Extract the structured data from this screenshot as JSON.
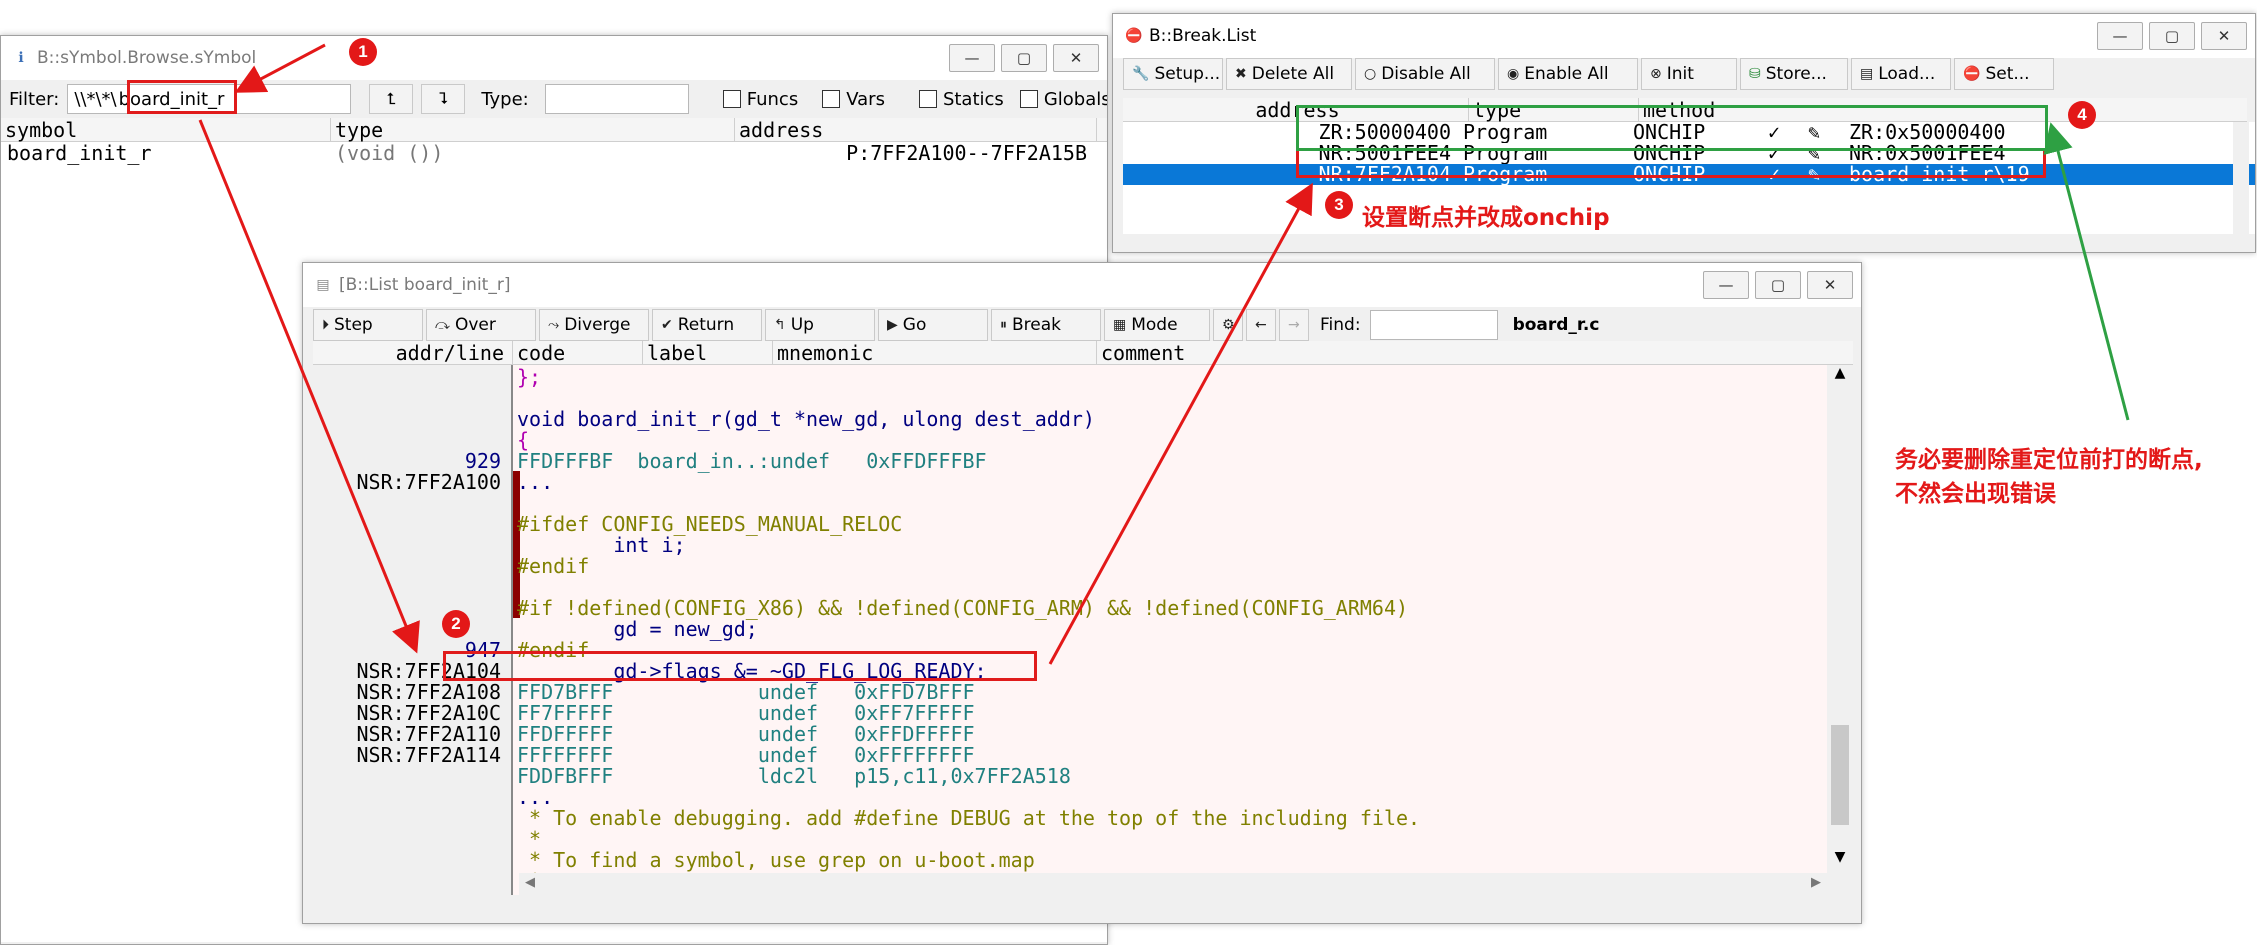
{
  "symbol_window": {
    "title": "B::sYmbol.Browse.sYmbol",
    "filter_label": "Filter:",
    "filter_prefix": "\\\\*\\*\\",
    "filter_value": "board_init_r",
    "type_label": "Type:",
    "type_value": "",
    "checkboxes": [
      "Funcs",
      "Vars",
      "Statics",
      "Globals"
    ],
    "columns": [
      "symbol",
      "type",
      "address"
    ],
    "rows": [
      {
        "symbol": "board_init_r",
        "type": "(void ())",
        "address": "P:7FF2A100--7FF2A15B"
      }
    ]
  },
  "break_window": {
    "title": "B::Break.List",
    "buttons": [
      "Setup...",
      "Delete All",
      "Disable All",
      "Enable All",
      "Init",
      "Store...",
      "Load...",
      "Set..."
    ],
    "columns": [
      "address",
      "type",
      "method"
    ],
    "rows": [
      {
        "address": "ZR:50000400",
        "type": "Program",
        "method": "ONCHIP",
        "check": "✓",
        "action": "ZR:0x50000400",
        "selected": false
      },
      {
        "address": "NR:5001FEE4",
        "type": "Program",
        "method": "ONCHIP",
        "check": "✓",
        "action": "NR:0x5001FEE4",
        "selected": false
      },
      {
        "address": "NR:7FF2A104",
        "type": "Program",
        "method": "ONCHIP",
        "check": "✓",
        "action": "board_init_r\\19",
        "selected": true
      }
    ]
  },
  "list_window": {
    "title": "[B::List board_init_r]",
    "buttons": [
      "Step",
      "Over",
      "Diverge",
      "Return",
      "Up",
      "Go",
      "Break",
      "Mode"
    ],
    "find_label": "Find:",
    "find_value": "",
    "file_name": "board_r.c",
    "columns": [
      "addr/line",
      "code",
      "label",
      "mnemonic",
      "comment"
    ],
    "gutter": [
      {
        "line": 5,
        "text": "929"
      },
      {
        "line": 6,
        "text": "NSR:7FF2A100"
      },
      {
        "line": 14,
        "text": "947"
      },
      {
        "line": 15,
        "text": "NSR:7FF2A104"
      },
      {
        "line": 16,
        "text": "NSR:7FF2A108"
      },
      {
        "line": 17,
        "text": "NSR:7FF2A10C"
      },
      {
        "line": 18,
        "text": "NSR:7FF2A110"
      },
      {
        "line": 19,
        "text": "NSR:7FF2A114"
      }
    ],
    "lines": [
      {
        "text": "};",
        "color": "#b000b0"
      },
      {
        "text": "",
        "color": "#000"
      },
      {
        "text": "void board_init_r(gd_t *new_gd, ulong dest_addr)",
        "color": "#000080"
      },
      {
        "text": "{",
        "color": "#b000b0"
      },
      {
        "text": "FFDFFFBF  board_in..:undef   0xFFDFFFBF",
        "color": "#208080"
      },
      {
        "text": "...",
        "color": "#000080"
      },
      {
        "text": "",
        "color": "#000"
      },
      {
        "text": "#ifdef CONFIG_NEEDS_MANUAL_RELOC",
        "color": "#808000"
      },
      {
        "text": "        int i;",
        "color": "#000080"
      },
      {
        "text": "#endif",
        "color": "#808000"
      },
      {
        "text": "",
        "color": "#000"
      },
      {
        "text": "#if !defined(CONFIG_X86) && !defined(CONFIG_ARM) && !defined(CONFIG_ARM64)",
        "color": "#808000"
      },
      {
        "text": "        gd = new_gd;",
        "color": "#000080"
      },
      {
        "text": "#endif",
        "color": "#808000"
      },
      {
        "text": "        gd->flags &= ~GD_FLG_LOG_READY;",
        "color": "#000080"
      },
      {
        "text": "FFD7BFFF            undef   0xFFD7BFFF",
        "color": "#208080"
      },
      {
        "text": "FF7FFFFF            undef   0xFF7FFFFF",
        "color": "#208080"
      },
      {
        "text": "FFDFFFFF            undef   0xFFDFFFFF",
        "color": "#208080"
      },
      {
        "text": "FFFFFFFF            undef   0xFFFFFFFF",
        "color": "#208080"
      },
      {
        "text": "FDDFBFFF            ldc2l   p15,c11,0x7FF2A518",
        "color": "#208080"
      },
      {
        "text": "...",
        "color": "#000080"
      },
      {
        "text": " * To enable debugging. add #define DEBUG at the top of the including file.",
        "color": "#808000"
      },
      {
        "text": " *",
        "color": "#808000"
      },
      {
        "text": " * To find a symbol, use grep on u-boot.map",
        "color": "#808000"
      },
      {
        "text": " */",
        "color": "#808000"
      }
    ]
  },
  "annotations": {
    "markers": [
      "1",
      "2",
      "3",
      "4"
    ],
    "note3": "设置断点并改成onchip",
    "note4_line1": "务必要删除重定位前打的断点,",
    "note4_line2": "不然会出现错误"
  },
  "colors": {
    "annotation_red": "#e31818",
    "annotation_green": "#2ea043",
    "selection_blue": "#0a78d7",
    "code_background": "#fff5f5",
    "breakpoint_bar": "#8b0000"
  }
}
